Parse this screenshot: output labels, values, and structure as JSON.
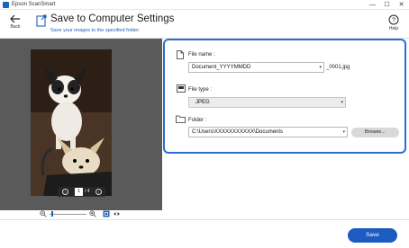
{
  "window": {
    "app_title": "Epson ScanSmart",
    "minimize_glyph": "—",
    "maximize_glyph": "☐",
    "close_glyph": "✕"
  },
  "header": {
    "back_label": "Back",
    "title": "Save to Computer Settings",
    "subtitle": "Save your images to the specified folder.",
    "help_label": "Help",
    "icon": "export-computer-icon"
  },
  "preview": {
    "current_page": "1",
    "total_pages": "/ 4",
    "prev_glyph": "‹",
    "next_glyph": "›"
  },
  "settings": {
    "file_name": {
      "label": "File name :",
      "value": "Document_YYYYMMDD",
      "suffix": "_0001.jpg"
    },
    "file_type": {
      "label": "File type :",
      "value": "JPEG"
    },
    "folder": {
      "label": "Folder :",
      "value": "C:\\Users\\XXXXXXXXXXX\\Documents",
      "browse_label": "Browse..."
    }
  },
  "footer": {
    "save_label": "Save"
  },
  "colors": {
    "accent": "#1c5bbf",
    "highlight_border": "#2a6dd0"
  }
}
